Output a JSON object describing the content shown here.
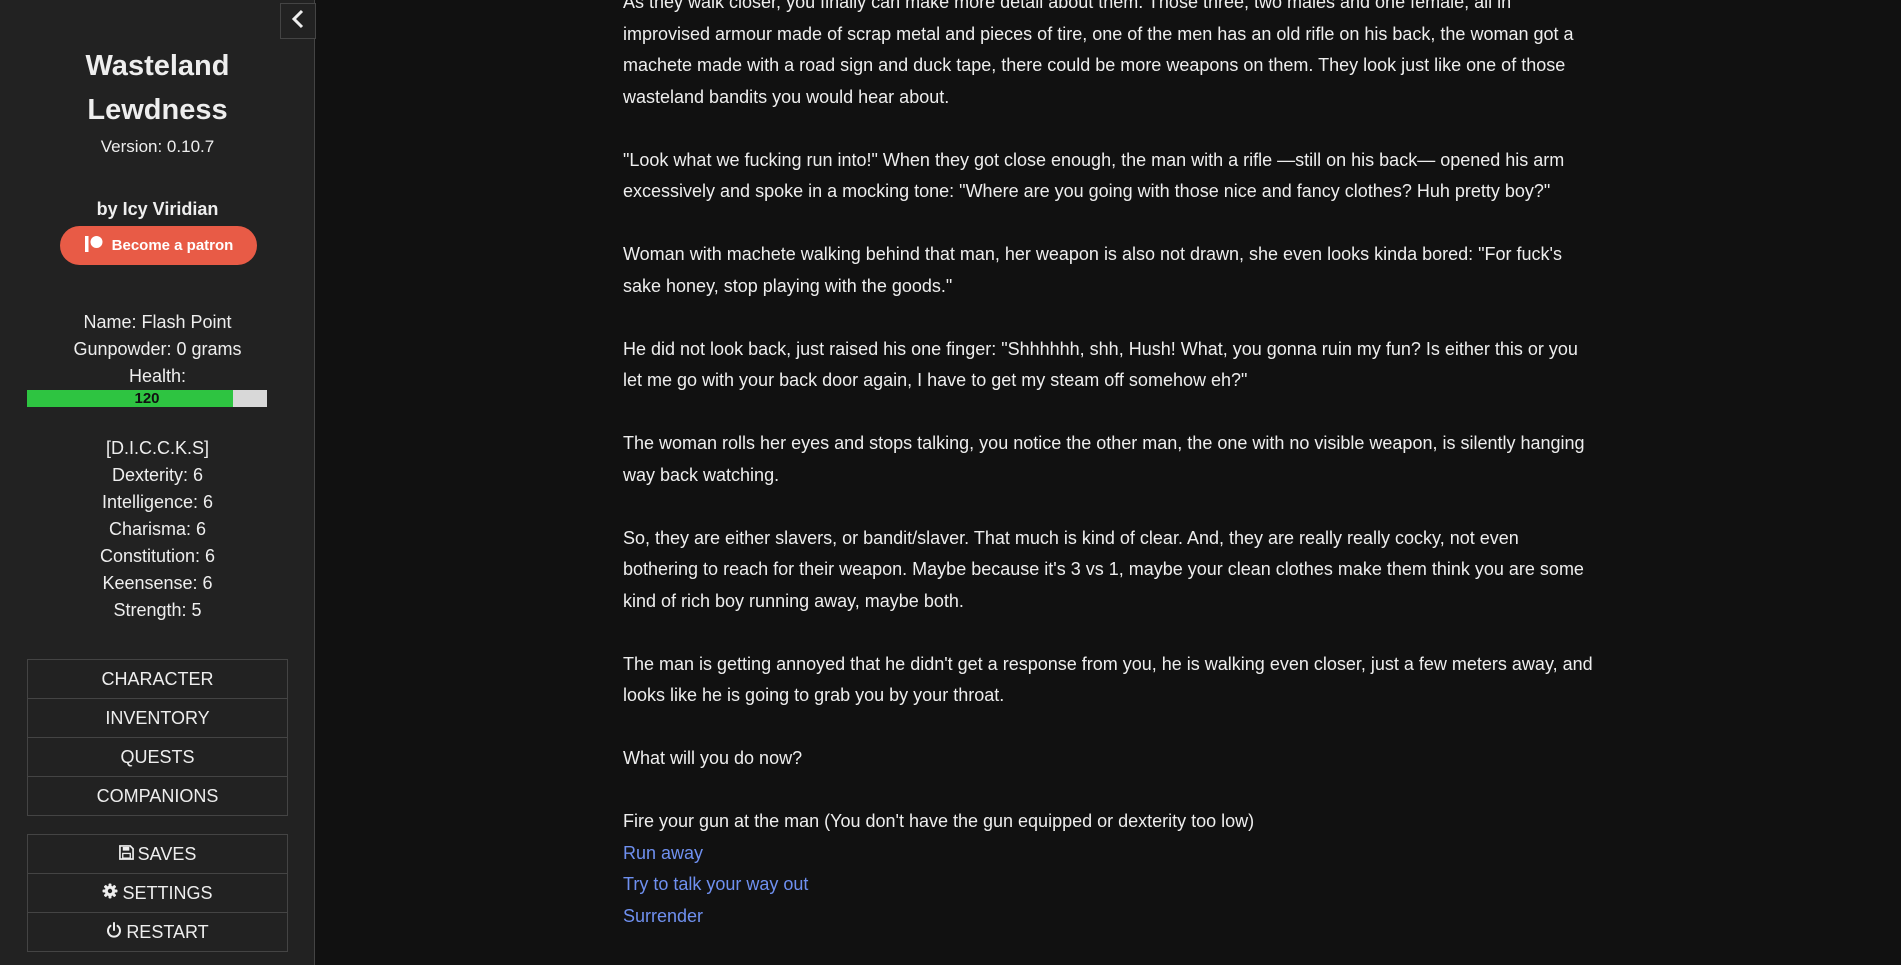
{
  "sidebar": {
    "title_line1": "Wasteland",
    "title_line2": "Lewdness",
    "version": "Version: 0.10.7",
    "author": "by Icy Viridian",
    "patron_label": "Become a patron",
    "stats": {
      "name": "Name: Flash Point",
      "gunpowder": "Gunpowder: 0 grams",
      "health_label": "Health:",
      "health_value": "120",
      "health_fraction": 0.86
    },
    "attributes": {
      "header": "[D.I.C.C.K.S]",
      "dexterity": "Dexterity: 6",
      "intelligence": "Intelligence: 6",
      "charisma": "Charisma: 6",
      "constitution": "Constitution: 6",
      "keensense": "Keensense: 6",
      "strength": "Strength: 5"
    },
    "menu": {
      "character": "CHARACTER",
      "inventory": "INVENTORY",
      "quests": "QUESTS",
      "companions": "COMPANIONS"
    },
    "system": {
      "saves": "SAVES",
      "settings": "SETTINGS",
      "restart": "RESTART"
    }
  },
  "story": {
    "paragraphs": [
      "As they walk closer, you finally can make more detail about them. Those three, two males and one female, all in improvised armour made of scrap metal and pieces of tire, one of the men has an old rifle on his back, the woman got a machete made with a road sign and duck tape, there could be more weapons on them. They look just like one of those wasteland bandits you would hear about.",
      "\"Look what we fucking run into!\" When they got close enough, the man with a rifle —still on his back— opened his arm excessively and spoke in a mocking tone: \"Where are you going with those nice and fancy clothes? Huh pretty boy?\"",
      "Woman with machete walking behind that man, her weapon is also not drawn, she even looks kinda bored: \"For fuck's sake honey, stop playing with the goods.\"",
      "He did not look back, just raised his one finger: \"Shhhhhh, shh, Hush! What, you gonna ruin my fun? Is either this or you let me go with your back door again, I have to get my steam off somehow eh?\"",
      "The woman rolls her eyes and stops talking, you notice the other man, the one with no visible weapon, is silently hanging way back watching.",
      "So, they are either slavers, or bandit/slaver. That much is kind of clear. And, they are really really cocky, not even bothering to reach for their weapon. Maybe because it's 3 vs 1, maybe your clean clothes make them think you are some kind of rich boy running away, maybe both.",
      "The man is getting annoyed that he didn't get a response from you, he is walking even closer, just a few meters away, and looks like he is going to grab you by your throat.",
      "What will you do now?"
    ],
    "choices": {
      "fire_gun": "Fire your gun at the man (You don't have the gun equipped or dexterity too low)",
      "run_away": "Run away",
      "talk_out": "Try to talk your way out",
      "surrender": "Surrender"
    }
  },
  "colors": {
    "background": "#111111",
    "sidebar": "#222222",
    "link": "#6f90f0",
    "patron": "#e85b46",
    "health": "#2ec441"
  }
}
